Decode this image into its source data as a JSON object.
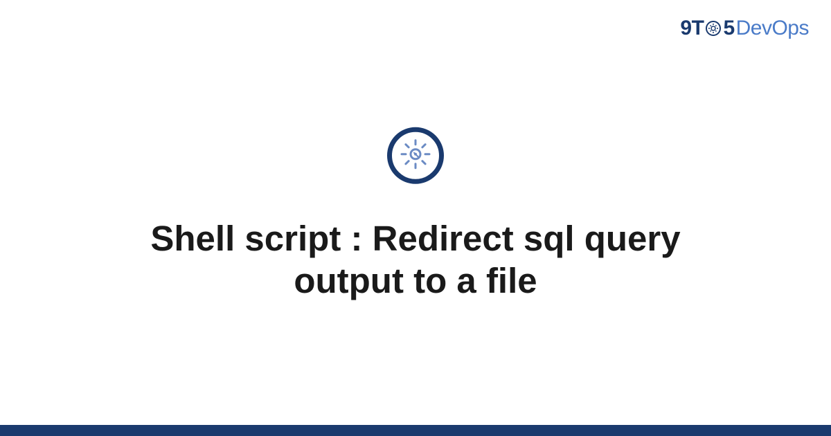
{
  "logo": {
    "part1": "9",
    "part2": "T",
    "part3": "5",
    "part4": "DevOps"
  },
  "title": "Shell script : Redirect sql query output to a file",
  "colors": {
    "primary": "#1a3a6e",
    "accent": "#4a7bc8"
  }
}
